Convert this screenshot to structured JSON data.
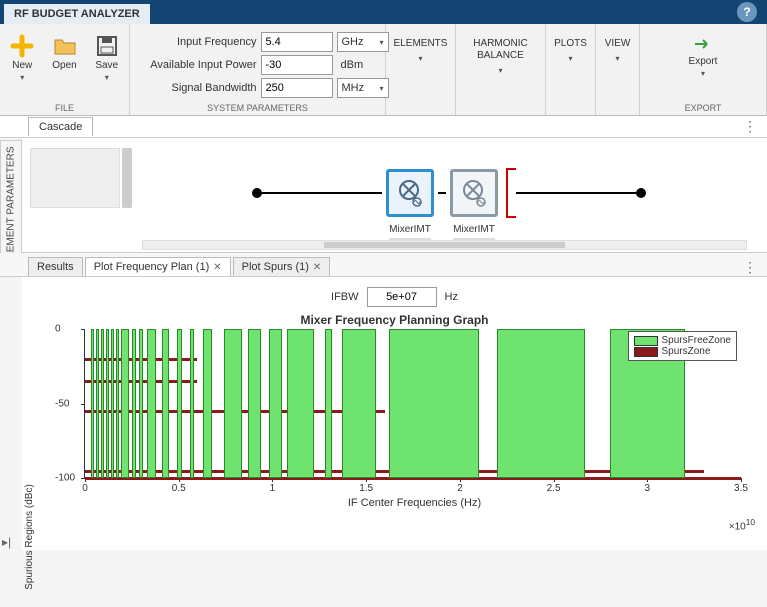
{
  "titlebar": {
    "title": "RF BUDGET ANALYZER"
  },
  "toolstrip": {
    "file": {
      "label": "FILE",
      "new": "New",
      "open": "Open",
      "save": "Save"
    },
    "params": {
      "label": "SYSTEM PARAMETERS",
      "inputFreq": {
        "label": "Input Frequency",
        "value": "5.4",
        "unit": "GHz"
      },
      "availPower": {
        "label": "Available Input Power",
        "value": "-30",
        "unit": "dBm"
      },
      "bandwidth": {
        "label": "Signal Bandwidth",
        "value": "250",
        "unit": "MHz"
      }
    },
    "elements": "ELEMENTS",
    "harmonic": "HARMONIC\nBALANCE",
    "plots": "PLOTS",
    "view": "VIEW",
    "export": {
      "group": "EXPORT",
      "btn": "Export"
    }
  },
  "sidebar": {
    "label": "ELEMENT PARAMETERS"
  },
  "cascade": {
    "tab": "Cascade",
    "block1": "MixerIMT",
    "block2": "MixerIMT"
  },
  "tabs2": {
    "results": "Results",
    "freqplan": "Plot Frequency Plan (1)",
    "spurs": "Plot Spurs (1)"
  },
  "ifbw": {
    "label": "IFBW",
    "value": "5e+07",
    "unit": "Hz"
  },
  "chart_data": {
    "type": "bar",
    "title": "Mixer Frequency Planning Graph",
    "xlabel": "IF Center Frequencies (Hz)",
    "ylabel": "Spurious Regions (dBc)",
    "x_multiplier": "×10^10",
    "x_ticks": [
      0,
      0.5,
      1,
      1.5,
      2,
      2.5,
      3,
      3.5
    ],
    "y_ticks": [
      0,
      -50,
      -100
    ],
    "xlim": [
      0,
      3.5
    ],
    "ylim": [
      -100,
      0
    ],
    "legend": [
      "SpursFreeZone",
      "SpursZone"
    ],
    "spurs_free_zones": [
      [
        0.03,
        0.05
      ],
      [
        0.06,
        0.075
      ],
      [
        0.085,
        0.1
      ],
      [
        0.11,
        0.13
      ],
      [
        0.14,
        0.155
      ],
      [
        0.165,
        0.18
      ],
      [
        0.19,
        0.235
      ],
      [
        0.25,
        0.27
      ],
      [
        0.29,
        0.31
      ],
      [
        0.33,
        0.38
      ],
      [
        0.41,
        0.45
      ],
      [
        0.49,
        0.52
      ],
      [
        0.56,
        0.58
      ],
      [
        0.63,
        0.68
      ],
      [
        0.74,
        0.84
      ],
      [
        0.87,
        0.94
      ],
      [
        0.98,
        1.05
      ],
      [
        1.08,
        1.22
      ],
      [
        1.28,
        1.32
      ],
      [
        1.37,
        1.55
      ],
      [
        1.62,
        2.1
      ],
      [
        2.2,
        2.67
      ],
      [
        2.8,
        3.2
      ]
    ],
    "spurs_zone_levels": [
      {
        "x0": 0.0,
        "x1": 3.5,
        "y": -100
      },
      {
        "x0": 0.0,
        "x1": 3.3,
        "y": -95
      },
      {
        "x0": 0.0,
        "x1": 1.6,
        "y": -55
      },
      {
        "x0": 0.0,
        "x1": 0.6,
        "y": -35
      },
      {
        "x0": 0.0,
        "x1": 0.6,
        "y": -20
      }
    ]
  }
}
